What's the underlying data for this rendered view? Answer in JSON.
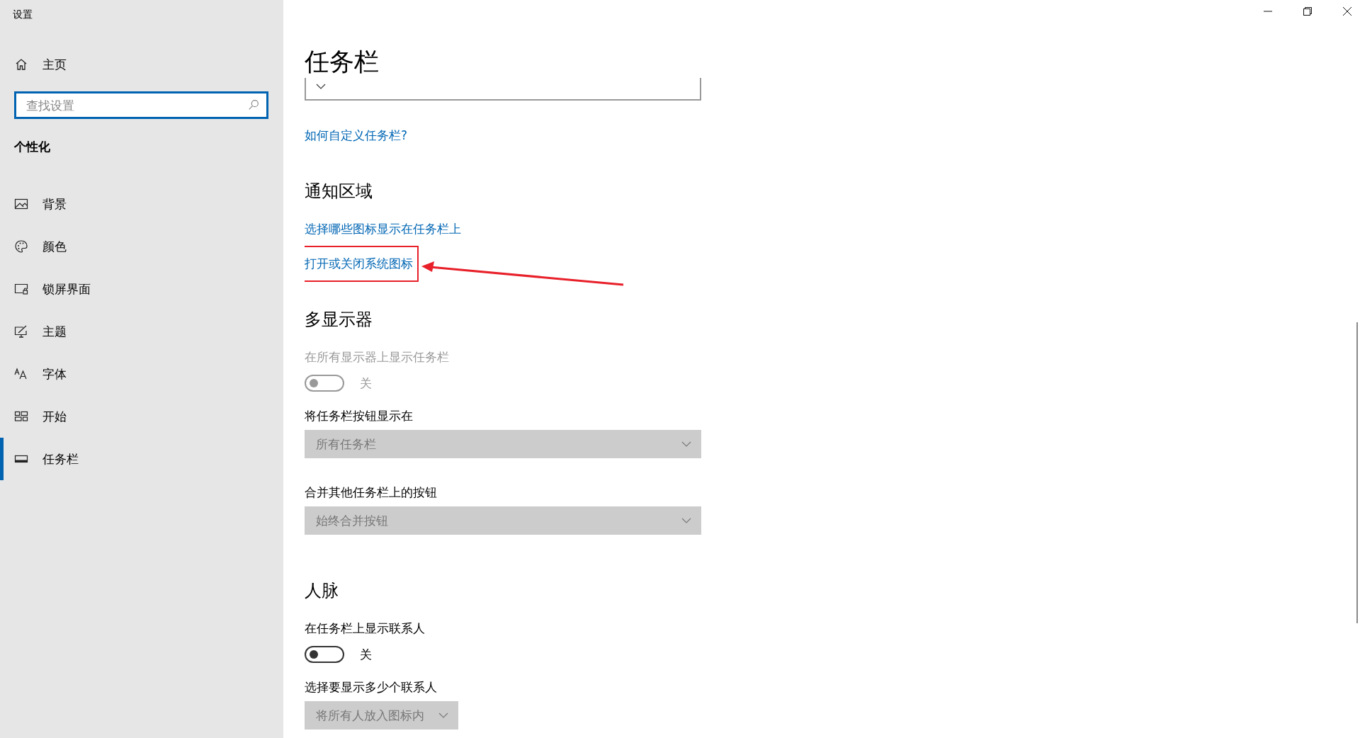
{
  "window": {
    "title": "设置"
  },
  "sidebar": {
    "home": "主页",
    "search": {
      "placeholder": "查找设置"
    },
    "section": "个性化",
    "items": [
      {
        "label": "背景",
        "kind": "image",
        "selected": false
      },
      {
        "label": "颜色",
        "kind": "palette",
        "selected": false
      },
      {
        "label": "锁屏界面",
        "kind": "lockscreen",
        "selected": false
      },
      {
        "label": "主题",
        "kind": "theme",
        "selected": false
      },
      {
        "label": "字体",
        "kind": "font",
        "selected": false
      },
      {
        "label": "开始",
        "kind": "start",
        "selected": false
      },
      {
        "label": "任务栏",
        "kind": "taskbar",
        "selected": true
      }
    ]
  },
  "content": {
    "title": "任务栏",
    "blocks": [
      {
        "kind": "dropdown",
        "disabled": false,
        "wide": true
      },
      {
        "kind": "link",
        "text": "如何自定义任务栏?",
        "highlighted": false
      },
      {
        "kind": "heading",
        "text": "通知区域"
      },
      {
        "kind": "link",
        "text": "选择哪些图标显示在任务栏上",
        "highlighted": false
      },
      {
        "kind": "link",
        "text": "打开或关闭系统图标",
        "highlighted": true
      },
      {
        "kind": "heading",
        "text": "多显示器"
      },
      {
        "kind": "label",
        "text": "在所有显示器上显示任务栏",
        "disabled": true
      },
      {
        "kind": "toggle",
        "on": false,
        "disabled": true,
        "state_text": "关"
      },
      {
        "kind": "label",
        "text": "将任务栏按钮显示在",
        "disabled": false
      },
      {
        "kind": "dropdown",
        "value": "所有任务栏",
        "disabled": true,
        "wide": true
      },
      {
        "kind": "label",
        "text": "合并其他任务栏上的按钮",
        "disabled": false
      },
      {
        "kind": "dropdown",
        "value": "始终合并按钮",
        "disabled": true,
        "wide": true
      },
      {
        "kind": "heading",
        "text": "人脉"
      },
      {
        "kind": "label",
        "text": "在任务栏上显示联系人",
        "disabled": false
      },
      {
        "kind": "toggle",
        "on": false,
        "disabled": false,
        "state_text": "关"
      },
      {
        "kind": "label",
        "text": "选择要显示多少个联系人",
        "disabled": false
      },
      {
        "kind": "dropdown",
        "value": "将所有人放入图标内",
        "disabled": true,
        "wide": false
      }
    ]
  }
}
